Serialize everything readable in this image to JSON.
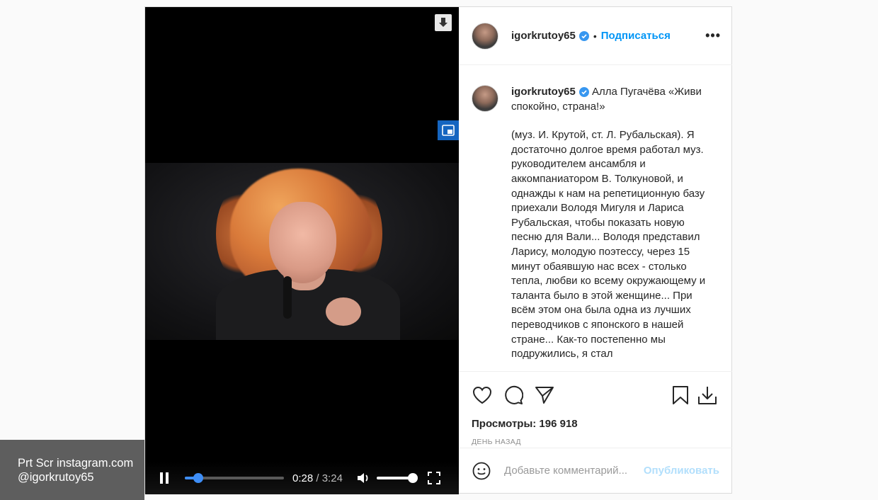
{
  "video": {
    "current_time": "0:28",
    "total_time": "3:24",
    "separator": " / ",
    "progress": 0.137,
    "volume": 1.0
  },
  "header": {
    "username": "igorkrutoy65",
    "dot": "•",
    "follow_label": "Подписаться",
    "more_label": "•••"
  },
  "caption": {
    "username": "igorkrutoy65",
    "title": "Алла Пугачёва «Живи спокойно, страна!»",
    "body": "(муз. И. Крутой, ст. Л. Рубальская). Я достаточно долгое время работал муз. руководителем ансамбля и аккомпаниатором В. Толкуновой, и однажды к нам на репетиционную базу приехали Володя Мигуля и Лариса Рубальская, чтобы показать новую песню для Вали... Володя представил Ларису, молодую поэтессу, через 15 минут обаявшую нас всех - столько тепла, любви ко всему окружающему и таланта было в этой женщине... При всём этом она была одна из лучших переводчиков с японского в нашей стране... Как-то постепенно мы подружились, я стал"
  },
  "stats": {
    "views_label": "Просмотры: 196 918",
    "posted_ago": "ДЕНЬ НАЗАД"
  },
  "comment": {
    "placeholder": "Добавьте комментарий...",
    "publish_label": "Опубликовать"
  },
  "watermark": {
    "line1": "Prt Scr instagram.com",
    "line2": "@igorkrutoy65"
  },
  "colors": {
    "accent": "#0095f6",
    "verified": "#3897f0",
    "seek": "#3e8ef7",
    "publish_disabled": "#b2dffc"
  },
  "icons": [
    "download-icon",
    "picture-in-picture-icon",
    "pause-icon",
    "volume-icon",
    "fullscreen-icon",
    "verified-icon",
    "heart-icon",
    "comment-icon",
    "share-icon",
    "bookmark-icon",
    "save-download-icon",
    "emoji-icon"
  ]
}
